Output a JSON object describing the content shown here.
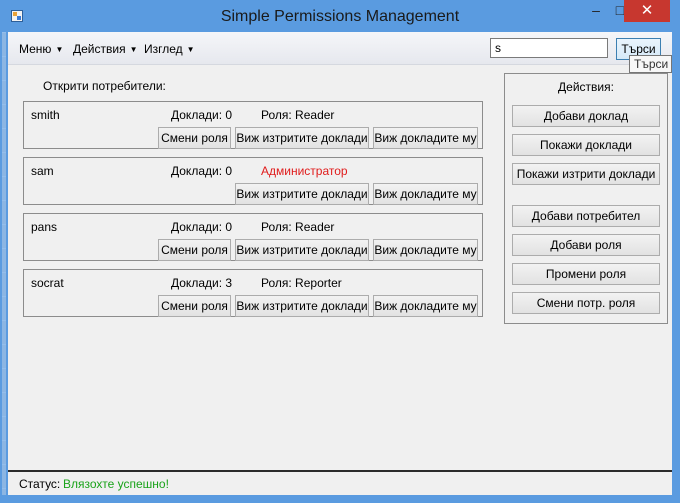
{
  "window": {
    "title": "Simple Permissions Management",
    "controls": {
      "minimize": "–",
      "maximize": "□",
      "close": "✕"
    }
  },
  "menu": [
    {
      "label": "Меню",
      "arrow": "▼"
    },
    {
      "label": "Действия",
      "arrow": "▼"
    },
    {
      "label": "Изглед",
      "arrow": "▼"
    }
  ],
  "search": {
    "value": "s",
    "button": "Търси",
    "tooltip": "Търси"
  },
  "users_section_label": "Открити потребители:",
  "users": [
    {
      "name": "smith",
      "reports": "Доклади: 0",
      "role": "Роля: Reader",
      "is_admin": false,
      "change_role": "Смени роля",
      "view_deleted": "Виж изтритите доклади",
      "view_reports": "Виж докладите му"
    },
    {
      "name": "sam",
      "reports": "Доклади: 0",
      "role": "Администратор",
      "is_admin": true,
      "change_role": "",
      "view_deleted": "Виж изтритите доклади",
      "view_reports": "Виж докладите му"
    },
    {
      "name": "pans",
      "reports": "Доклади: 0",
      "role": "Роля: Reader",
      "is_admin": false,
      "change_role": "Смени роля",
      "view_deleted": "Виж изтритите доклади",
      "view_reports": "Виж докладите му"
    },
    {
      "name": "socrat",
      "reports": "Доклади: 3",
      "role": "Роля: Reporter",
      "is_admin": false,
      "change_role": "Смени роля",
      "view_deleted": "Виж изтритите доклади",
      "view_reports": "Виж докладите му"
    }
  ],
  "actions": {
    "title": "Действия:",
    "buttons": [
      "Добави доклад",
      "Покажи доклади",
      "Покажи изтрити доклади",
      "Добави потребител",
      "Добави роля",
      "Промени роля",
      "Смени потр. роля"
    ]
  },
  "status": {
    "label": "Статус:",
    "value": "Влязохте успешно!",
    "value_color": "#1aa31a"
  },
  "colors": {
    "admin_role": "#e01b1b",
    "titlebar": "#5a9be0",
    "close_button": "#c7372f"
  }
}
